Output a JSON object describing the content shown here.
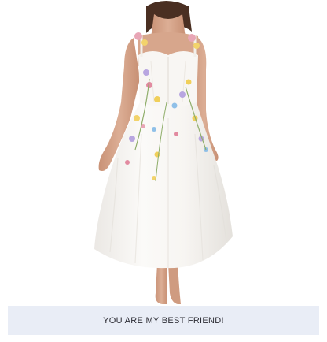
{
  "caption": {
    "text": "YOU ARE MY BEST FRIEND!"
  },
  "colors": {
    "background": "#ffffff",
    "caption_bar": "#e9edf6",
    "caption_text": "#2b2b33",
    "dress": "#f7f5f2",
    "skin": "#d8a88e",
    "hair": "#4a2f22"
  },
  "photo": {
    "subject": "white tulle midi dress with 3D floral embroidery worn by model"
  }
}
